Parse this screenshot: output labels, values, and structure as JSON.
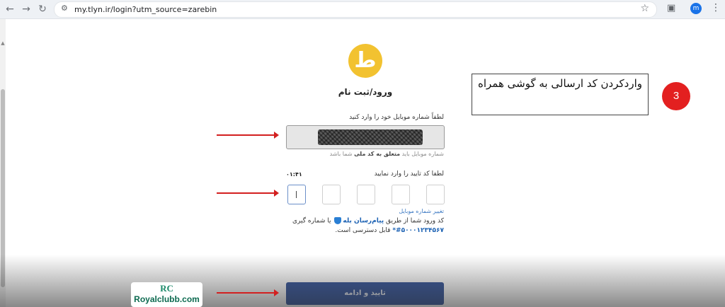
{
  "browser": {
    "back_icon": "←",
    "forward_icon": "→",
    "reload_icon": "↻",
    "url": "my.tlyn.ir/login?utm_source=zarebin",
    "avatar_letter": "m",
    "bookmark_icon": "☆",
    "menu_icon": "⋮"
  },
  "login": {
    "logo_glyph": "ط",
    "title": "ورود/ثبت نام",
    "phone_label": "لطفاً شماره موبایل خود را وارد کنید",
    "phone_hint_prefix": "شماره موبایل باید ",
    "phone_hint_bold": "متعلق به کد ملی",
    "phone_hint_suffix": " شما باشد",
    "code_label": "لطفا کد تایید را وارد نمایید",
    "timer": "۰۱:۴۱",
    "change_number": "تغییر شماره موبایل",
    "sms_prefix": "کد ورود شما از طریق ",
    "sms_brand": "پیام‌رسان بله",
    "sms_suffix": " یا شماره گیری",
    "sms_number": "#۵۰۰۰۱۲۳۴۵۶۷*",
    "sms_end": " قابل دسترسی است.",
    "submit": "تایید و ادامه"
  },
  "annotation": {
    "callout": "واردکردن کد ارسالی به گوشی همراه",
    "step": "3",
    "arrow_color": "#d32020"
  },
  "watermark": {
    "mark": "RC",
    "text": "Royalclubb.com"
  },
  "colors": {
    "logo": "#f2c230",
    "submit": "#3b5a9e",
    "link": "#3b78c2",
    "badge": "#e32020"
  }
}
